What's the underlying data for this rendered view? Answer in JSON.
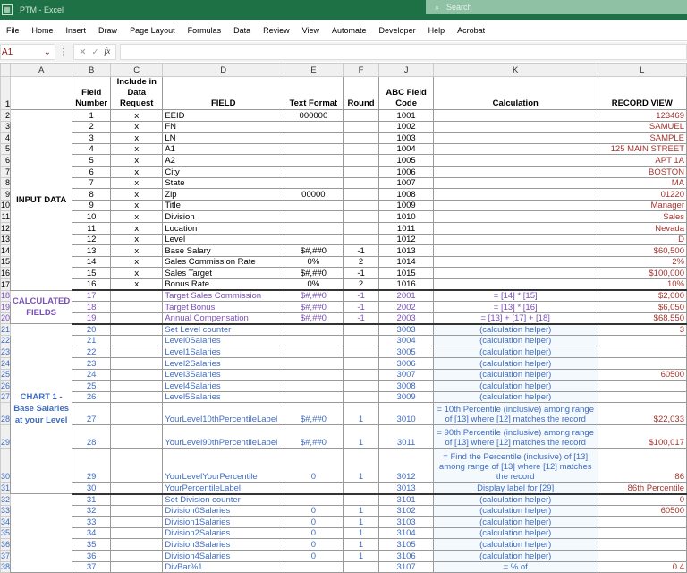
{
  "window": {
    "title": "PTM - Excel",
    "search_placeholder": "Search"
  },
  "menu": [
    "File",
    "Home",
    "Insert",
    "Draw",
    "Page Layout",
    "Formulas",
    "Data",
    "Review",
    "View",
    "Automate",
    "Developer",
    "Help",
    "Acrobat"
  ],
  "formula_bar": {
    "name_box": "A1",
    "value": ""
  },
  "columns": [
    "A",
    "B",
    "C",
    "D",
    "E",
    "F",
    "J",
    "K",
    "L"
  ],
  "header": {
    "b": "Field Number",
    "c": "Include in Data Request",
    "d": "FIELD",
    "e": "Text Format",
    "f": "Round",
    "j": "ABC Field Code",
    "k": "Calculation",
    "l": "RECORD VIEW"
  },
  "sections": {
    "input": "INPUT DATA",
    "calc": "CALCULATED FIELDS",
    "chart": "CHART 1 - Base Salaries at your Level"
  },
  "rows": [
    {
      "row": "2",
      "field": "1",
      "inc": "x",
      "name": "EEID",
      "fmt": "000000",
      "round": "",
      "code": "1001",
      "calc": "",
      "val": "123469"
    },
    {
      "row": "3",
      "field": "2",
      "inc": "x",
      "name": "FN",
      "fmt": "",
      "round": "",
      "code": "1002",
      "calc": "",
      "val": "SAMUEL"
    },
    {
      "row": "4",
      "field": "3",
      "inc": "x",
      "name": "LN",
      "fmt": "",
      "round": "",
      "code": "1003",
      "calc": "",
      "val": "SAMPLE"
    },
    {
      "row": "5",
      "field": "4",
      "inc": "x",
      "name": "A1",
      "fmt": "",
      "round": "",
      "code": "1004",
      "calc": "",
      "val": "125 MAIN STREET"
    },
    {
      "row": "6",
      "field": "5",
      "inc": "x",
      "name": "A2",
      "fmt": "",
      "round": "",
      "code": "1005",
      "calc": "",
      "val": "APT 1A"
    },
    {
      "row": "7",
      "field": "6",
      "inc": "x",
      "name": "City",
      "fmt": "",
      "round": "",
      "code": "1006",
      "calc": "",
      "val": "BOSTON"
    },
    {
      "row": "8",
      "field": "7",
      "inc": "x",
      "name": "State",
      "fmt": "",
      "round": "",
      "code": "1007",
      "calc": "",
      "val": "MA"
    },
    {
      "row": "9",
      "field": "8",
      "inc": "x",
      "name": "Zip",
      "fmt": "00000",
      "round": "",
      "code": "1008",
      "calc": "",
      "val": "01220"
    },
    {
      "row": "10",
      "field": "9",
      "inc": "x",
      "name": "Title",
      "fmt": "",
      "round": "",
      "code": "1009",
      "calc": "",
      "val": "Manager"
    },
    {
      "row": "11",
      "field": "10",
      "inc": "x",
      "name": "Division",
      "fmt": "",
      "round": "",
      "code": "1010",
      "calc": "",
      "val": "Sales"
    },
    {
      "row": "12",
      "field": "11",
      "inc": "x",
      "name": "Location",
      "fmt": "",
      "round": "",
      "code": "1011",
      "calc": "",
      "val": "Nevada"
    },
    {
      "row": "13",
      "field": "12",
      "inc": "x",
      "name": "Level",
      "fmt": "",
      "round": "",
      "code": "1012",
      "calc": "",
      "val": "D"
    },
    {
      "row": "14",
      "field": "13",
      "inc": "x",
      "name": "Base Salary",
      "fmt": "$#,##0",
      "round": "-1",
      "code": "1013",
      "calc": "",
      "val": "$60,500"
    },
    {
      "row": "15",
      "field": "14",
      "inc": "x",
      "name": "Sales Commission Rate",
      "fmt": "0%",
      "round": "2",
      "code": "1014",
      "calc": "",
      "val": "2%"
    },
    {
      "row": "16",
      "field": "15",
      "inc": "x",
      "name": "Sales Target",
      "fmt": "$#,##0",
      "round": "-1",
      "code": "1015",
      "calc": "",
      "val": "$100,000"
    },
    {
      "row": "17",
      "field": "16",
      "inc": "x",
      "name": "Bonus Rate",
      "fmt": "0%",
      "round": "2",
      "code": "1016",
      "calc": "",
      "val": "10%"
    },
    {
      "row": "18",
      "field": "17",
      "inc": "",
      "name": "Target Sales Commission",
      "fmt": "$#,##0",
      "round": "-1",
      "code": "2001",
      "calc": "= [14] * [15]",
      "val": "$2,000"
    },
    {
      "row": "19",
      "field": "18",
      "inc": "",
      "name": "Target Bonus",
      "fmt": "$#,##0",
      "round": "-1",
      "code": "2002",
      "calc": "= [13] * [16]",
      "val": "$6,050"
    },
    {
      "row": "20",
      "field": "19",
      "inc": "",
      "name": "Annual Compensation",
      "fmt": "$#,##0",
      "round": "-1",
      "code": "2003",
      "calc": "= [13] + [17] + [18]",
      "val": "$68,550"
    },
    {
      "row": "21",
      "field": "20",
      "inc": "",
      "name": "Set Level counter",
      "fmt": "",
      "round": "",
      "code": "3003",
      "calc": "(calculation helper)",
      "val": "3"
    },
    {
      "row": "22",
      "field": "21",
      "inc": "",
      "name": "Level0Salaries",
      "fmt": "",
      "round": "",
      "code": "3004",
      "calc": "(calculation helper)",
      "val": ""
    },
    {
      "row": "23",
      "field": "22",
      "inc": "",
      "name": "Level1Salaries",
      "fmt": "",
      "round": "",
      "code": "3005",
      "calc": "(calculation helper)",
      "val": ""
    },
    {
      "row": "24",
      "field": "23",
      "inc": "",
      "name": "Level2Salaries",
      "fmt": "",
      "round": "",
      "code": "3006",
      "calc": "(calculation helper)",
      "val": ""
    },
    {
      "row": "25",
      "field": "24",
      "inc": "",
      "name": "Level3Salaries",
      "fmt": "",
      "round": "",
      "code": "3007",
      "calc": "(calculation helper)",
      "val": "60500"
    },
    {
      "row": "26",
      "field": "25",
      "inc": "",
      "name": "Level4Salaries",
      "fmt": "",
      "round": "",
      "code": "3008",
      "calc": "(calculation helper)",
      "val": ""
    },
    {
      "row": "27",
      "field": "26",
      "inc": "",
      "name": "Level5Salaries",
      "fmt": "",
      "round": "",
      "code": "3009",
      "calc": "(calculation helper)",
      "val": ""
    },
    {
      "row": "28",
      "field": "27",
      "inc": "",
      "name": "YourLevel10thPercentileLabel",
      "fmt": "$#,##0",
      "round": "1",
      "code": "3010",
      "calc": "= 10th Percentile (inclusive) among range of [13] where [12] matches the record",
      "val": "$22,033"
    },
    {
      "row": "29",
      "field": "28",
      "inc": "",
      "name": "YourLevel90thPercentileLabel",
      "fmt": "$#,##0",
      "round": "1",
      "code": "3011",
      "calc": "= 90th Percentile (inclusive) among range of [13] where [12] matches the record",
      "val": "$100,017"
    },
    {
      "row": "30",
      "field": "29",
      "inc": "",
      "name": "YourLevelYourPercentile",
      "fmt": "0",
      "round": "1",
      "code": "3012",
      "calc": "= Find the Percentile (inclusive) of [13] among range of [13] where [12] matches the record",
      "val": "86"
    },
    {
      "row": "31",
      "field": "30",
      "inc": "",
      "name": "YourPercentileLabel",
      "fmt": "",
      "round": "",
      "code": "3013",
      "calc": "Display label for [29]",
      "val": "86th Percentile"
    },
    {
      "row": "32",
      "field": "31",
      "inc": "",
      "name": "Set Division counter",
      "fmt": "",
      "round": "",
      "code": "3101",
      "calc": "(calculation helper)",
      "val": "0"
    },
    {
      "row": "33",
      "field": "32",
      "inc": "",
      "name": "Division0Salaries",
      "fmt": "0",
      "round": "1",
      "code": "3102",
      "calc": "(calculation helper)",
      "val": "60500"
    },
    {
      "row": "34",
      "field": "33",
      "inc": "",
      "name": "Division1Salaries",
      "fmt": "0",
      "round": "1",
      "code": "3103",
      "calc": "(calculation helper)",
      "val": ""
    },
    {
      "row": "35",
      "field": "34",
      "inc": "",
      "name": "Division2Salaries",
      "fmt": "0",
      "round": "1",
      "code": "3104",
      "calc": "(calculation helper)",
      "val": ""
    },
    {
      "row": "36",
      "field": "35",
      "inc": "",
      "name": "Division3Salaries",
      "fmt": "0",
      "round": "1",
      "code": "3105",
      "calc": "(calculation helper)",
      "val": ""
    },
    {
      "row": "37",
      "field": "36",
      "inc": "",
      "name": "Division4Salaries",
      "fmt": "0",
      "round": "1",
      "code": "3106",
      "calc": "(calculation helper)",
      "val": ""
    },
    {
      "row": "38",
      "field": "37",
      "inc": "",
      "name": "DivBar%1",
      "fmt": "",
      "round": "",
      "code": "3107",
      "calc": "= % of",
      "val": "0.4"
    }
  ]
}
